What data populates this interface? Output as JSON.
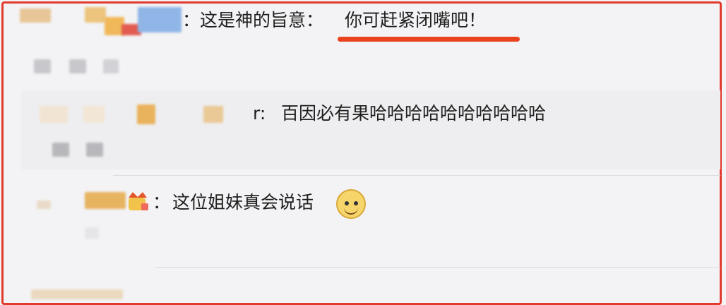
{
  "comments": [
    {
      "text": "：这是神的旨意：",
      "highlight": "你可赶紧闭嘴吧！"
    },
    {
      "text": "百因必有果哈哈哈哈哈哈哈哈哈哈"
    },
    {
      "text": "这位姐妹真会说话"
    }
  ],
  "colors": {
    "frame": "#e23a2e",
    "underline": "#e8421f"
  },
  "icons": {
    "crown_badge": "crown-icon",
    "emoji": "dog-emoji-icon"
  }
}
